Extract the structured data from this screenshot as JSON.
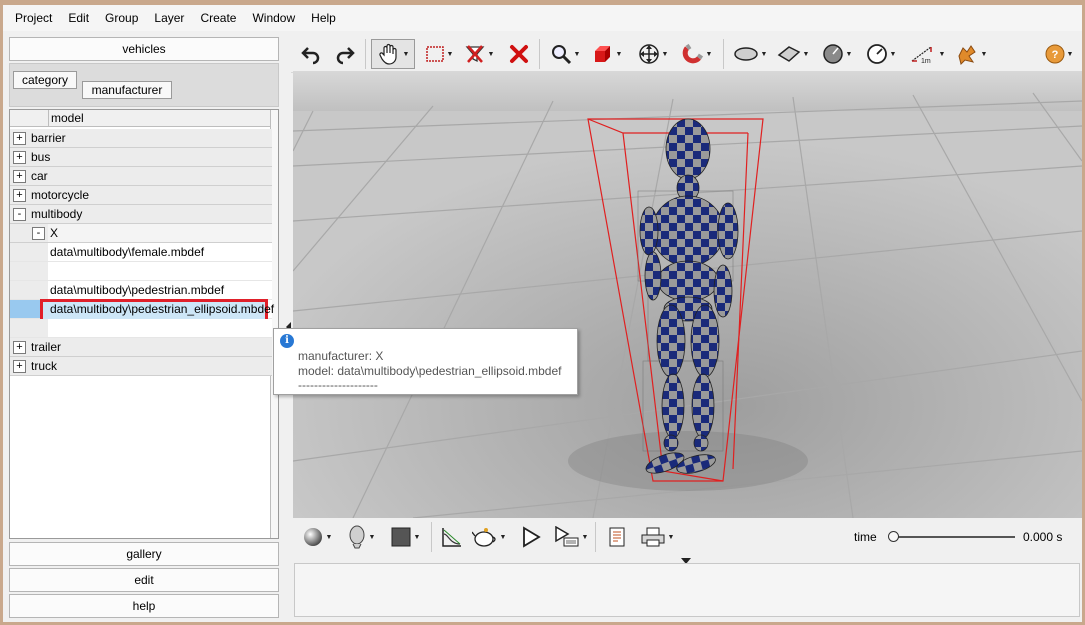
{
  "menu": [
    "Project",
    "Edit",
    "Group",
    "Layer",
    "Create",
    "Window",
    "Help"
  ],
  "left_panel": {
    "header_button": "vehicles",
    "tabs": [
      "category",
      "manufacturer"
    ],
    "tree_column": "model",
    "tree": [
      {
        "label": "barrier",
        "expander": "+"
      },
      {
        "label": "bus",
        "expander": "+"
      },
      {
        "label": "car",
        "expander": "+"
      },
      {
        "label": "motorcycle",
        "expander": "+"
      },
      {
        "label": "multibody",
        "expander": "-"
      },
      {
        "label": "X",
        "expander": "-"
      },
      {
        "label": "data\\multibody\\female.mbdef"
      },
      {
        "label": ""
      },
      {
        "label": "data\\multibody\\pedestrian.mbdef"
      },
      {
        "label": "data\\multibody\\pedestrian_ellipsoid.mbdef"
      },
      {
        "label": "trailer",
        "expander": "+"
      },
      {
        "label": "truck",
        "expander": "+"
      }
    ],
    "bottom_buttons": [
      "gallery",
      "edit",
      "help"
    ]
  },
  "tooltip": {
    "manufacturer": "manufacturer: X",
    "model": "model: data\\multibody\\pedestrian_ellipsoid.mbdef",
    "separator": "--------------------"
  },
  "toolbar": {
    "icons": [
      "undo-icon",
      "redo-icon",
      "pan-hand-icon",
      "select-rectangle-icon",
      "select-filter-icon",
      "delete-icon",
      "zoom-icon",
      "cube-icon",
      "move-icon",
      "snap-magnet-icon",
      "ellipse-icon",
      "plane-icon",
      "sphere-icon",
      "gauge-icon",
      "measure-icon",
      "gear-puzzle-icon",
      "help-icon"
    ],
    "measure_label": "1m"
  },
  "bottom_bar": {
    "time_label": "time",
    "time_value": "0.000 s",
    "time_fraction": 0
  },
  "colors": {
    "selection_border": "#e0202a",
    "selection_fill": "#cde6f7",
    "bounding_box": "#e02020",
    "body_blue": "#1a2a7a",
    "body_gray": "#9a9a9a"
  }
}
